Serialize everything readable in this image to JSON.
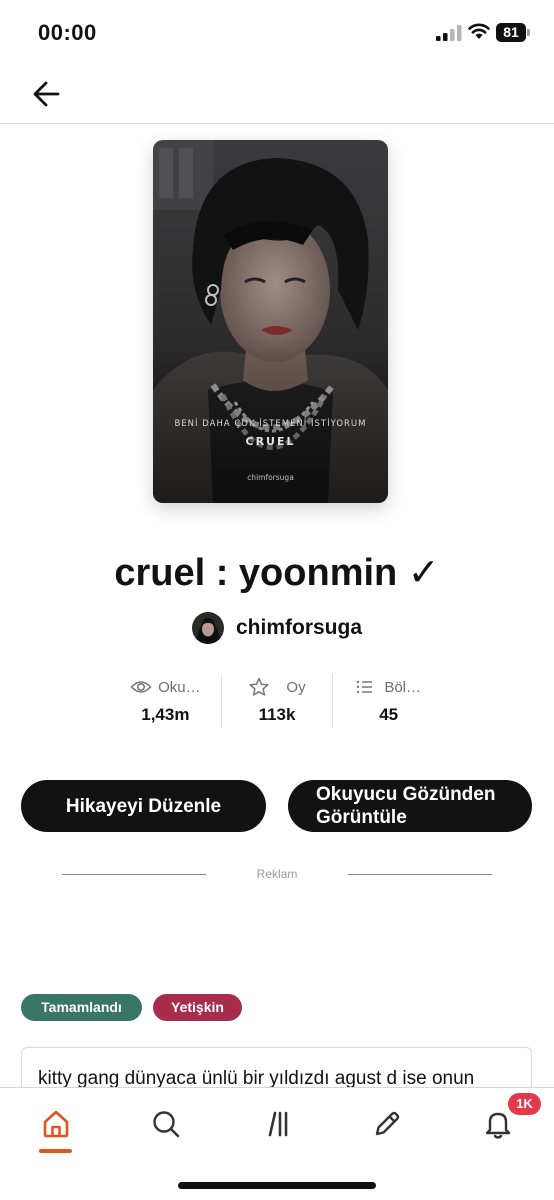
{
  "status_bar": {
    "time": "00:00",
    "battery": "81"
  },
  "cover": {
    "tagline": "BENİ DAHA ÇOK İSTEMENİ İSTİYORUM",
    "title": "CRUEL",
    "author": "chimforsuga"
  },
  "story": {
    "title": "cruel : yoonmin ✓",
    "author": "chimforsuga"
  },
  "stats": [
    {
      "icon": "eye-icon",
      "label": "Oku…",
      "value": "1,43m"
    },
    {
      "icon": "star-icon",
      "label": "Oy",
      "value": "113k"
    },
    {
      "icon": "list-icon",
      "label": "Böl…",
      "value": "45"
    }
  ],
  "actions": {
    "edit_label": "Hikayeyi Düzenle",
    "reader_view_label": "Okuyucu Gözünden Görüntüle"
  },
  "ad_label": "Reklam",
  "tags": {
    "completed": "Tamamlandı",
    "mature": "Yetişkin"
  },
  "description_preview": "kitty gang dünyaca ünlü bir yıldızdı agust d ise onun",
  "tab_bar": {
    "active": "home",
    "notification_badge": "1K",
    "accent_color": "#e6541b"
  }
}
